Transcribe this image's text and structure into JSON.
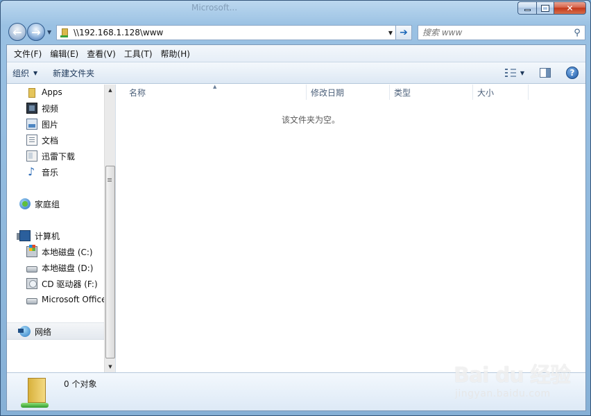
{
  "window": {
    "ghost_title": "Microsoft...",
    "caption": {
      "minimize": "▁",
      "maximize": "□",
      "close": "✕"
    }
  },
  "navigation": {
    "back_glyph": "←",
    "forward_glyph": "→",
    "address": "\\\\192.168.1.128\\www",
    "dropdown_glyph": "▼",
    "go_glyph": "➔",
    "search_placeholder": "搜索 www",
    "search_glyph": "⚲"
  },
  "menubar": {
    "items": [
      "文件(F)",
      "编辑(E)",
      "查看(V)",
      "工具(T)",
      "帮助(H)"
    ]
  },
  "toolbar": {
    "organize": "组织",
    "new_folder": "新建文件夹",
    "help_glyph": "?"
  },
  "nav_pane": {
    "favorites": [
      {
        "label": "Apps",
        "icon": "folder-icon"
      },
      {
        "label": "视频",
        "icon": "video-library-icon"
      },
      {
        "label": "图片",
        "icon": "pictures-library-icon"
      },
      {
        "label": "文档",
        "icon": "documents-library-icon"
      },
      {
        "label": "迅雷下载",
        "icon": "download-library-icon"
      },
      {
        "label": "音乐",
        "icon": "music-library-icon"
      }
    ],
    "homegroup": "家庭组",
    "computer": "计算机",
    "drives": [
      {
        "label": "本地磁盘 (C:)",
        "icon": "system-drive-icon"
      },
      {
        "label": "本地磁盘 (D:)",
        "icon": "hard-drive-icon"
      },
      {
        "label": "CD 驱动器 (F:)",
        "icon": "cd-drive-icon"
      },
      {
        "label": "Microsoft Office",
        "icon": "hard-drive-icon"
      }
    ],
    "network": "网络"
  },
  "columns": [
    "名称",
    "修改日期",
    "类型",
    "大小"
  ],
  "empty_message": "该文件夹为空。",
  "details": {
    "item_count": "0 个对象"
  },
  "watermark": {
    "brand": "Bai du 经验",
    "url": "jingyan.baidu.com"
  },
  "colors": {
    "frame": "#8fb8dc",
    "toolbar": "#dde8f4",
    "selection_text": "#1e395b"
  }
}
